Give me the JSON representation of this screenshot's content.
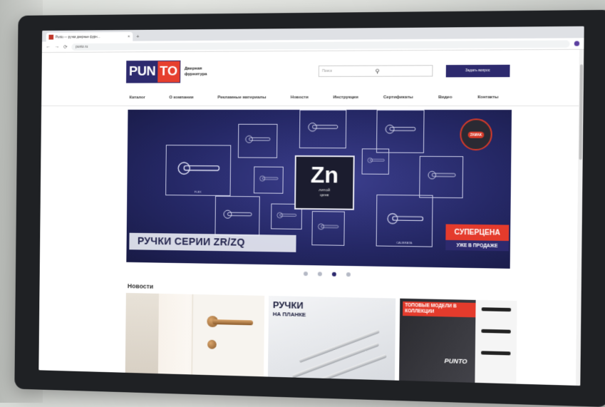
{
  "browser": {
    "tab_title": "Punto — ручки дверные фурн…",
    "tab_close": "×",
    "new_tab": "+",
    "url": "punto.ru",
    "nav_back": "←",
    "nav_forward": "→",
    "nav_reload": "⟳",
    "menu_dots": "⋮"
  },
  "header": {
    "logo_left": "PUN",
    "logo_right": "TO",
    "tagline": "Дверная фурнитура",
    "search_placeholder": "Поиск",
    "search_icon": "search-icon",
    "cta": "Задать вопрос"
  },
  "menu": {
    "items": [
      "Каталог",
      "О компании",
      "Рекламные материалы",
      "Новости",
      "Инструкции",
      "Сертификаты",
      "Видео",
      "Контакты"
    ]
  },
  "banner": {
    "element_symbol": "Zn",
    "element_sub1": "литой",
    "element_sub2": "цинк",
    "stamp": "ZAMAK",
    "headline": "РУЧКИ СЕРИИ ZR/ZQ",
    "badge": "СУПЕРЦЕНА",
    "badge_sub": "УЖЕ В ПРОДАЖЕ",
    "frame_labels": [
      "FLEX",
      "",
      "",
      "",
      "",
      "",
      "",
      "",
      "",
      "",
      "CALIBRATA"
    ]
  },
  "carousel": {
    "active_index": 2,
    "count": 4
  },
  "news": {
    "title": "Новости",
    "card2_title": "РУЧКИ",
    "card2_sub": "НА ПЛАНКЕ",
    "card3_title": "ТОПОВЫЕ МОДЕЛИ В КОЛЛЕКЦИИ",
    "card3_logo": "PUNTO"
  },
  "colors": {
    "brand_navy": "#2d2a6e",
    "brand_red": "#e63f2e",
    "banner_bg": "#252866"
  }
}
